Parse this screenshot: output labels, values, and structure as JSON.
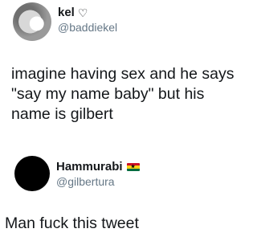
{
  "tweet1": {
    "display_name": "kel",
    "heart": "♡",
    "handle": "@baddiekel",
    "text_lines": [
      "imagine having sex and he says",
      "\"say my name baby\" but his",
      "name is gilbert"
    ]
  },
  "tweet2": {
    "display_name": "Hammurabi",
    "handle": "@gilbertura",
    "flag_colors": [
      "#ce1126",
      "#fcd116",
      "#006b3f"
    ],
    "flag_star": "★",
    "text_lines": [
      "Man fuck this tweet"
    ]
  }
}
